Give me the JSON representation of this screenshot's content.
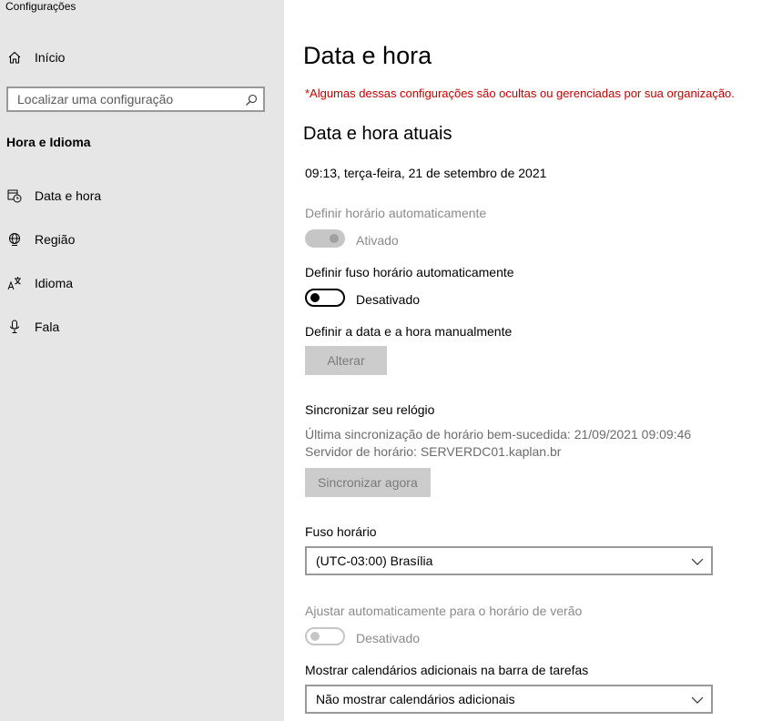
{
  "window": {
    "title": "Configurações"
  },
  "sidebar": {
    "home_label": "Início",
    "search": {
      "placeholder": "Localizar uma configuração"
    },
    "section_title": "Hora e Idioma",
    "items": [
      {
        "label": "Data e hora",
        "icon": "calendar-clock-icon"
      },
      {
        "label": "Região",
        "icon": "globe-icon"
      },
      {
        "label": "Idioma",
        "icon": "language-icon"
      },
      {
        "label": "Fala",
        "icon": "microphone-icon"
      }
    ]
  },
  "main": {
    "title": "Data e hora",
    "org_warning": "*Algumas dessas configurações são ocultas ou gerenciadas por sua organização.",
    "current_heading": "Data e hora atuais",
    "current_datetime": "09:13, terça-feira, 21 de setembro de 2021",
    "auto_time": {
      "label": "Definir horário automaticamente",
      "state": "Ativado"
    },
    "auto_timezone": {
      "label": "Definir fuso horário automaticamente",
      "state": "Desativado"
    },
    "manual": {
      "label": "Definir a data e a hora manualmente",
      "button": "Alterar"
    },
    "sync": {
      "heading": "Sincronizar seu relógio",
      "last_sync": "Última sincronização de horário bem-sucedida: 21/09/2021 09:09:46",
      "server": "Servidor de horário: SERVERDC01.kaplan.br",
      "button": "Sincronizar agora"
    },
    "timezone": {
      "label": "Fuso horário",
      "value": "(UTC-03:00) Brasília"
    },
    "dst": {
      "label": "Ajustar automaticamente para o horário de verão",
      "state": "Desativado"
    },
    "calendars": {
      "label": "Mostrar calendários adicionais na barra de tarefas",
      "value": "Não mostrar calendários adicionais"
    }
  },
  "colors": {
    "warning": "#c50000",
    "sidebar_bg": "#e6e6e6"
  }
}
